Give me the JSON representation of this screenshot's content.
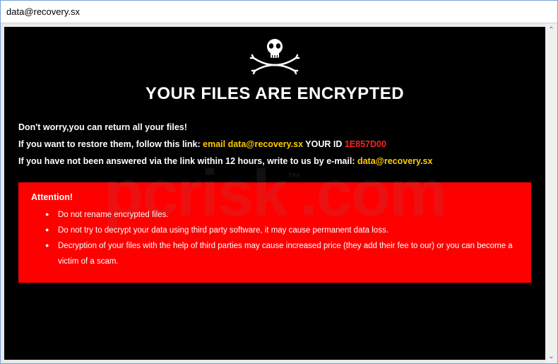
{
  "window": {
    "title": "data@recovery.sx"
  },
  "content": {
    "heading": "YOUR FILES ARE ENCRYPTED",
    "line1": "Don't worry,you can return all your files!",
    "line2_prefix": "If you want to restore them, follow this link: ",
    "line2_email_label": "email data@recovery.sx",
    "line2_yourid_label": "  YOUR ID ",
    "line2_id": "1E857D00",
    "line3_prefix": "If you have not been answered via the link within 12 hours, write to us by e-mail: ",
    "line3_email": "data@recovery.sx"
  },
  "attention": {
    "heading": "Attention!",
    "items": [
      "Do not rename encrypted files.",
      "Do not try to decrypt your data using third party software, it may cause permanent data loss.",
      "Decryption of your files with the help of third parties may cause increased price (they add their fee to our) or you can become a victim of a scam."
    ]
  },
  "watermark": {
    "brand": "pcrisk",
    "suffix": ".com",
    "tm": "™"
  },
  "scroll": {
    "up": "⌃",
    "down": "⌄"
  }
}
